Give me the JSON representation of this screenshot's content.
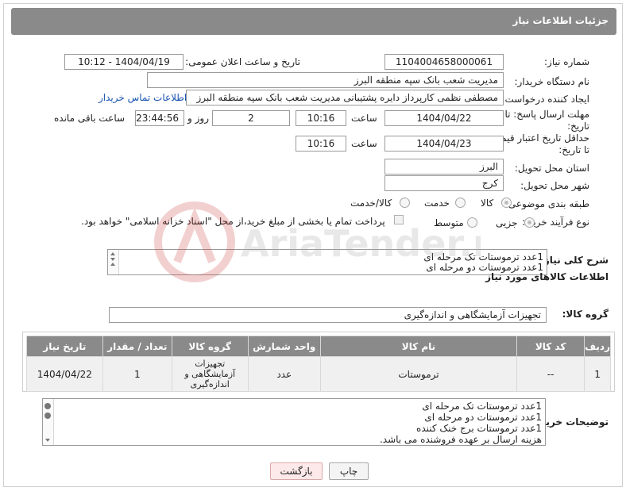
{
  "header": {
    "title": "جزئیات اطلاعات نیاز"
  },
  "form": {
    "need_number": {
      "label": "شماره نیاز:",
      "value": "1104004658000061"
    },
    "announce_datetime": {
      "label": "تاریخ و ساعت اعلان عمومی:",
      "value": "1404/04/19 - 10:12"
    },
    "buyer_org": {
      "label": "نام دستگاه خریدار:",
      "value": "مدیریت شعب بانک سپه منطقه البرز"
    },
    "requester": {
      "label": "ایجاد کننده درخواست:",
      "value": "مصطفی نظمی کارپرداز دایره پشتیبانی مدیریت شعب بانک سپه منطقه البرز",
      "contact_link": "اطلاعات تماس خریدار"
    },
    "reply_deadline": {
      "label_line1": "مهلت ارسال پاسخ: تا",
      "label_line2": "تاریخ:",
      "date": "1404/04/22",
      "time_label": "ساعت",
      "time": "10:16",
      "days": "2",
      "days_label": "روز و",
      "remaining": "23:44:56",
      "remaining_label": "ساعت باقی مانده"
    },
    "price_validity": {
      "label_line1": "حداقل تاریخ اعتبار قیمت:",
      "label_line2": "تا تاریخ:",
      "date": "1404/04/23",
      "time_label": "ساعت",
      "time": "10:16"
    },
    "province": {
      "label": "استان محل تحویل:",
      "value": "البرز"
    },
    "city": {
      "label": "شهر محل تحویل:",
      "value": "کرج"
    },
    "category": {
      "label": "طبقه بندی موضوعی:",
      "options": [
        "کالا",
        "خدمت",
        "کالا/خدمت"
      ],
      "selected": "کالا"
    },
    "purchase_type": {
      "label": "نوع فرآیند خرید :",
      "options": [
        "جزیی",
        "متوسط"
      ],
      "payment_note": "پرداخت تمام یا بخشی از مبلغ خرید،از محل \"اسناد خزانه اسلامی\" خواهد بود."
    },
    "general_desc": {
      "label": "شرح کلی نیاز:",
      "lines": [
        "1عدد ترموستات تک مرحله ای",
        "1عدد ترموستات دو مرحله ای"
      ]
    }
  },
  "goods_section": {
    "title": "اطلاعات کالاهای مورد نیاز",
    "group_label": "گروه کالا:",
    "group_value": "تجهیزات آزمایشگاهی و اندازه‌گیری",
    "table": {
      "headers": [
        "ردیف",
        "کد کالا",
        "نام کالا",
        "واحد شمارش",
        "گروه کالا",
        "تعداد / مقدار",
        "تاریخ نیاز"
      ],
      "rows": [
        [
          "1",
          "--",
          "ترموستات",
          "عدد",
          "تجهیزات آزمایشگاهی و اندازه‌گیری",
          "1",
          "1404/04/22"
        ]
      ]
    }
  },
  "buyer_notes": {
    "label": "توضیحات خریدار:",
    "lines": [
      "1عدد ترموستات تک مرحله ای",
      "1عدد ترموستات دو مرحله ای",
      "1عدد ترموستات برج خنک کننده",
      "هزینه ارسال بر عهده فروشنده می باشد."
    ]
  },
  "buttons": {
    "print": "چاپ",
    "back": "بازگشت"
  },
  "watermark_text": "AriaTender.neT",
  "colors": {
    "header_bg": "#8a8a8a",
    "link": "#1a55b0",
    "back_button_bg": "#fde9e9"
  }
}
